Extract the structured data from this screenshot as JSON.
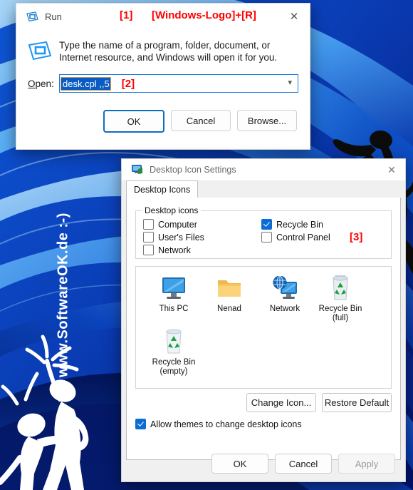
{
  "wallpaper": {
    "name": "windows-11-bloom-wallpaper",
    "colors": {
      "deep_blue": "#041a6b",
      "mid_blue": "#0b47c8",
      "bright_blue": "#2d8bf0",
      "light_blue": "#62b9f7",
      "pale_blue": "#9ed6fb"
    }
  },
  "watermark": {
    "text": "www.SoftwareOK.de  :-)",
    "color": "#ffffff"
  },
  "annotations": {
    "one": "[1]",
    "one_text": "[Windows-Logo]+[R]",
    "two": "[2]",
    "three": "[3]",
    "color": "#ff0000"
  },
  "run_dialog": {
    "title": "Run",
    "icon": "run-app-icon",
    "close_icon": "close-icon",
    "description": "Type the name of a program, folder, document, or Internet resource, and Windows will open it for you.",
    "open_label": "Open:",
    "open_label_accel": "O",
    "open_value": "desk.cpl ,,5",
    "open_placeholder": "",
    "dropdown_icon": "chevron-down-icon",
    "buttons": [
      {
        "label": "OK",
        "default": true,
        "disabled": false
      },
      {
        "label": "Cancel",
        "default": false,
        "disabled": false
      },
      {
        "label": "Browse...",
        "default": false,
        "disabled": false,
        "accel": "B"
      }
    ]
  },
  "desktop_icon_settings": {
    "title": "Desktop Icon Settings",
    "icon": "desktop-icon-settings-icon",
    "close_icon": "close-icon",
    "tabs": [
      {
        "label": "Desktop Icons",
        "active": true
      }
    ],
    "group_label": "Desktop icons",
    "checkboxes": [
      {
        "label": "Computer",
        "checked": false,
        "accel": "C"
      },
      {
        "label": "User's Files",
        "checked": false,
        "accel": "U"
      },
      {
        "label": "Network",
        "checked": false,
        "accel": "N"
      },
      {
        "label": "Recycle Bin",
        "checked": true,
        "accel": "R"
      },
      {
        "label": "Control Panel",
        "checked": false,
        "accel": "o"
      }
    ],
    "preview_icons": [
      {
        "label": "This PC",
        "icon": "this-pc-icon"
      },
      {
        "label": "Nenad",
        "icon": "user-folder-icon"
      },
      {
        "label": "Network",
        "icon": "network-icon"
      },
      {
        "label": "Recycle Bin\n(full)",
        "line1": "Recycle Bin",
        "line2": "(full)",
        "icon": "recycle-bin-full-icon"
      },
      {
        "label": "Recycle Bin\n(empty)",
        "line1": "Recycle Bin",
        "line2": "(empty)",
        "icon": "recycle-bin-empty-icon"
      }
    ],
    "action_buttons": [
      {
        "label": "Change Icon...",
        "accel": "h"
      },
      {
        "label": "Restore Default",
        "accel": "s"
      }
    ],
    "allow_themes": {
      "label": "Allow themes to change desktop icons",
      "checked": true,
      "accel": "A"
    },
    "footer_buttons": [
      {
        "label": "OK",
        "disabled": false
      },
      {
        "label": "Cancel",
        "disabled": false
      },
      {
        "label": "Apply",
        "disabled": true,
        "accel": "A"
      }
    ]
  }
}
